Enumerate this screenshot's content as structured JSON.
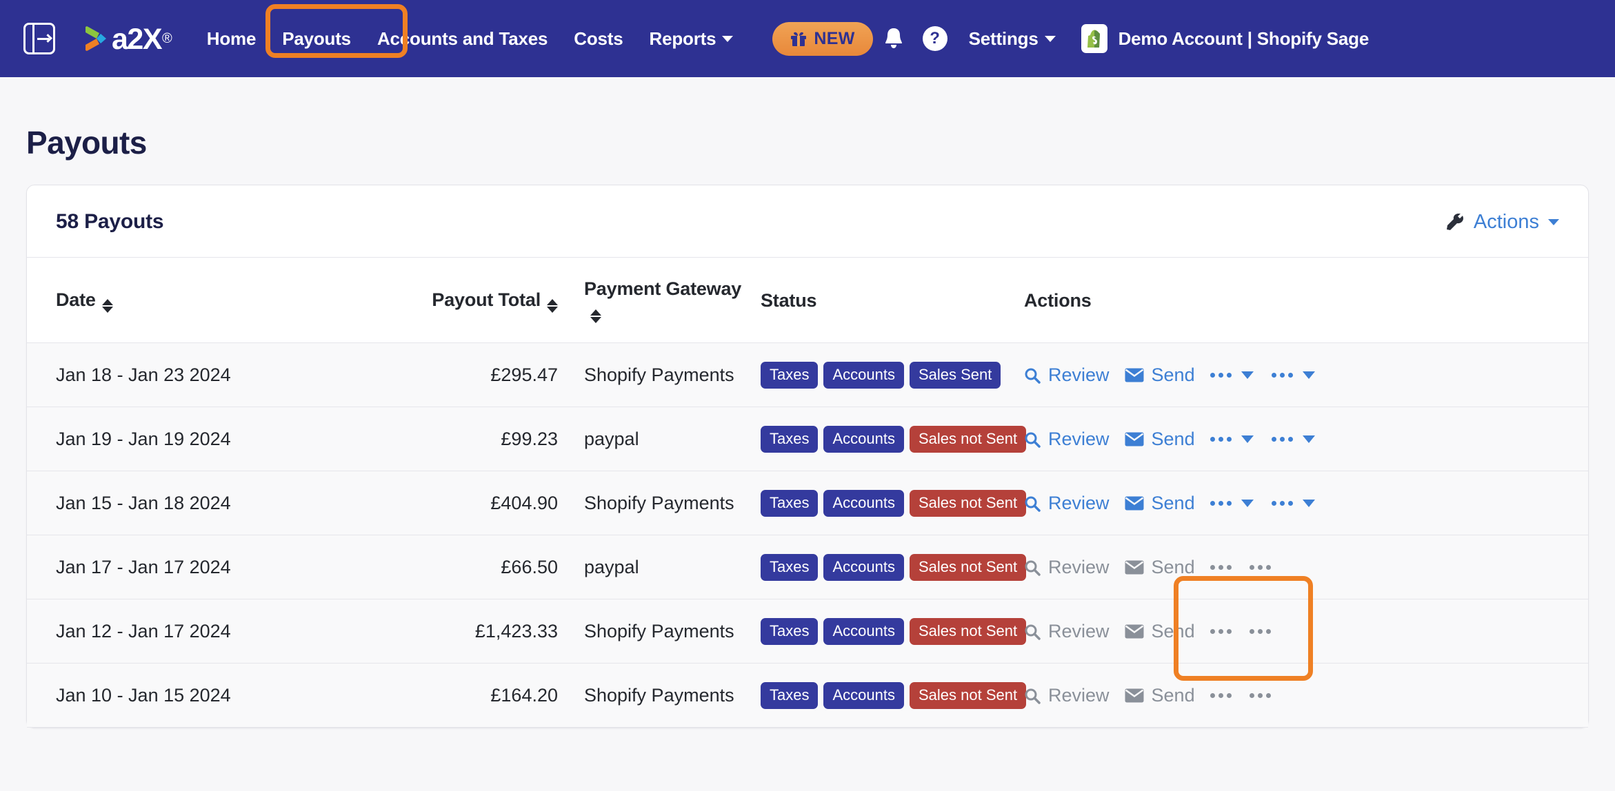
{
  "navbar": {
    "sidebar_toggle_icon": "sidebar-expand-icon",
    "brand": "a2X",
    "brand_dot": "®",
    "links": [
      {
        "label": "Home",
        "dropdown": false
      },
      {
        "label": "Payouts",
        "dropdown": false
      },
      {
        "label": "Accounts and Taxes",
        "dropdown": false
      },
      {
        "label": "Costs",
        "dropdown": false
      },
      {
        "label": "Reports",
        "dropdown": true
      }
    ],
    "new_badge": {
      "label": "NEW",
      "icon": "gift-icon"
    },
    "notification_icon": "bell-icon",
    "help_icon": "question-mark-icon",
    "help_glyph": "?",
    "settings": {
      "label": "Settings",
      "dropdown": true
    },
    "account": {
      "icon": "shopify-icon",
      "name": "Demo Account | Shopify Sage"
    },
    "colors": {
      "background": "#2e3192",
      "badge_orange": "#e8883a"
    }
  },
  "page": {
    "title": "Payouts"
  },
  "card": {
    "title": "58 Payouts",
    "actions_label": "Actions",
    "actions_icon": "wrench-icon",
    "actions_caret": "chevron-down-icon"
  },
  "table": {
    "columns": [
      {
        "label": "Date",
        "sortable": true,
        "align": "left"
      },
      {
        "label": "Payout Total",
        "sortable": true,
        "align": "right"
      },
      {
        "label": "Payment Gateway",
        "sortable": true,
        "align": "left"
      },
      {
        "label": "Status",
        "sortable": false,
        "align": "left"
      },
      {
        "label": "Actions",
        "sortable": false,
        "align": "left"
      }
    ],
    "action_labels": {
      "review": "Review",
      "send": "Send"
    },
    "rows": [
      {
        "date": "Jan 18 - Jan 23 2024",
        "total": "£295.47",
        "gateway": "Shopify Payments",
        "badges": [
          {
            "label": "Taxes",
            "color": "navy"
          },
          {
            "label": "Accounts",
            "color": "navy"
          },
          {
            "label": "Sales Sent",
            "color": "navy"
          }
        ],
        "enabled": true
      },
      {
        "date": "Jan 19 - Jan 19 2024",
        "total": "£99.23",
        "gateway": "paypal",
        "badges": [
          {
            "label": "Taxes",
            "color": "navy"
          },
          {
            "label": "Accounts",
            "color": "navy"
          },
          {
            "label": "Sales not Sent",
            "color": "red"
          }
        ],
        "enabled": true
      },
      {
        "date": "Jan 15 - Jan 18 2024",
        "total": "£404.90",
        "gateway": "Shopify Payments",
        "badges": [
          {
            "label": "Taxes",
            "color": "navy"
          },
          {
            "label": "Accounts",
            "color": "navy"
          },
          {
            "label": "Sales not Sent",
            "color": "red"
          }
        ],
        "enabled": true
      },
      {
        "date": "Jan 17 - Jan 17 2024",
        "total": "£66.50",
        "gateway": "paypal",
        "badges": [
          {
            "label": "Taxes",
            "color": "navy"
          },
          {
            "label": "Accounts",
            "color": "navy"
          },
          {
            "label": "Sales not Sent",
            "color": "red"
          }
        ],
        "enabled": false
      },
      {
        "date": "Jan 12 - Jan 17 2024",
        "total": "£1,423.33",
        "gateway": "Shopify Payments",
        "badges": [
          {
            "label": "Taxes",
            "color": "navy"
          },
          {
            "label": "Accounts",
            "color": "navy"
          },
          {
            "label": "Sales not Sent",
            "color": "red"
          }
        ],
        "enabled": false
      },
      {
        "date": "Jan 10 - Jan 15 2024",
        "total": "£164.20",
        "gateway": "Shopify Payments",
        "badges": [
          {
            "label": "Taxes",
            "color": "navy"
          },
          {
            "label": "Accounts",
            "color": "navy"
          },
          {
            "label": "Sales not Sent",
            "color": "red"
          }
        ],
        "enabled": false
      }
    ]
  },
  "annotations": {
    "color": "#ef8024",
    "boxes": [
      {
        "target": "nav-link-payouts"
      },
      {
        "target": "review-link-row-3"
      }
    ]
  }
}
